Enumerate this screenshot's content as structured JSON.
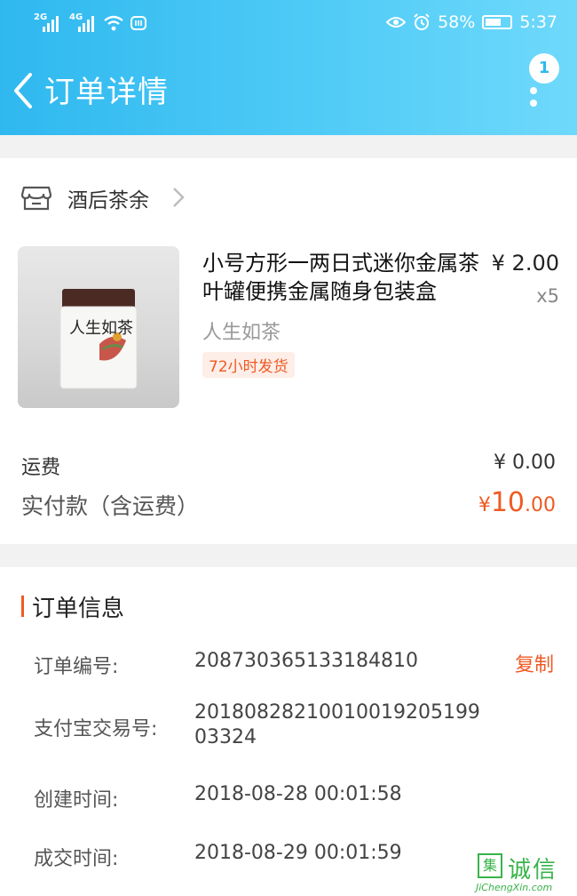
{
  "status_bar": {
    "sim1": "2G",
    "sim2": "4G",
    "battery": "58%",
    "time": "5:37"
  },
  "header": {
    "title": "订单详情",
    "badge": "1"
  },
  "shop": {
    "name": "酒后茶余"
  },
  "product": {
    "name": "小号方形一两日式迷你金属茶叶罐便携金属随身包装盒",
    "price": "¥ 2.00",
    "qty": "x5",
    "sku": "人生如茶",
    "tag": "72小时发货",
    "image_text": "人生如茶"
  },
  "summary": {
    "shipping_label": "运费",
    "shipping_value": "¥ 0.00",
    "paid_label": "实付款（含运费）",
    "paid_currency": "¥",
    "paid_int": "10",
    "paid_dec": ".00"
  },
  "order_info": {
    "title": "订单信息",
    "copy_label": "复制",
    "rows": [
      {
        "label": "订单编号:",
        "value": "208730365133184810"
      },
      {
        "label": "支付宝交易号:",
        "value": "20180828210010019205199 03324"
      },
      {
        "label": "创建时间:",
        "value": "2018-08-28 00:01:58"
      },
      {
        "label": "成交时间:",
        "value": "2018-08-29 00:01:59"
      }
    ]
  },
  "watermark": {
    "box": "集",
    "text": "诚信",
    "url": "JiChengXin.com"
  },
  "colors": {
    "header_start": "#2fb8ef",
    "accent": "#ef5a23",
    "watermark": "#38b34a"
  }
}
